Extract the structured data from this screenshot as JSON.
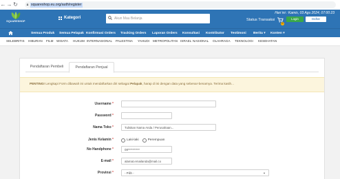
{
  "browser": {
    "url": "squareshop.eu.org/auth/register"
  },
  "header": {
    "logo_text": "SQUARESHOP",
    "kategori_label": "Kategori",
    "search_placeholder": "Akun Mau Belanja",
    "date_text": "Hari ini : Kamis, 03 Agu 2024, 07:00:23",
    "status_transaksi": "Status Transaksi",
    "cart_count": "0",
    "login_label": "Login",
    "daftar_label": "Daftar",
    "brand_color": "#2e74b5"
  },
  "nav": {
    "items": [
      "Semua Produk",
      "Semua Pelapak",
      "Konfirmasi Orders",
      "Tracking Orders",
      "Laporan Orders",
      "Konsultasi",
      "Kontributor",
      "Testimoni",
      "Berita ▾",
      "Konten ▾"
    ]
  },
  "categories": [
    "SELEBRITIS",
    "HIBURAN",
    "FILM",
    "WISATA",
    "HUKUM",
    "INTERNASIONAL",
    "PALESTINA",
    "YAHUDI",
    "METROPOLITAN",
    "ISRAEL",
    "NASIONAL",
    "OLAHRAGA",
    "TEKNOLOGI",
    "KESEHATAN"
  ],
  "tabs": [
    "Pendaftaran Pembeli",
    "Pendaftaran Penjual"
  ],
  "alert": {
    "prefix": "PENTING!",
    "text_before": " Lengkapi Form dibawah ini untuk mendaftarkan diri sebagai ",
    "bold": "Pelapak",
    "text_after": ", harap di isi dengan data yang sebenar-benarnya. Terima kasih..."
  },
  "form": {
    "username_label": "Username",
    "password_label": "Password",
    "nama_toko_label": "Nama Toko",
    "nama_toko_placeholder": "Tuliskan Nama Anda / Perusahaan...",
    "jenis_kelamin_label": "Jenis Kelamin",
    "radio_laki": "Laki-laki",
    "radio_perempuan": "Perempuan",
    "no_hp_label": "No Handphone",
    "no_hp_value": "08**********",
    "email_label": "E-mail",
    "email_value": "alamat.emailanda@mail.co",
    "provinsi_label": "Provinsi",
    "provinsi_value": "- Pilih -",
    "required_mark": "*"
  }
}
